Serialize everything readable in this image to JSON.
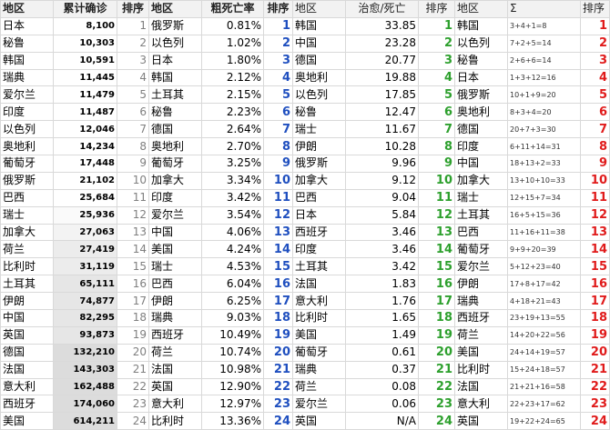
{
  "headers": {
    "region1": "地区",
    "cumulative": "累计确诊",
    "rank1": "排序",
    "region2": "地区",
    "mortality": "粗死亡率",
    "rank2": "排序",
    "region3": "地区",
    "recovery_death": "治愈/死亡",
    "rank3": "排序",
    "region4": "地区",
    "sigma": "Σ",
    "rank4": "排序"
  },
  "rows": [
    {
      "r1": "日本",
      "c": "8,100",
      "k1": "1",
      "r2": "俄罗斯",
      "m": "0.81%",
      "k2": "1",
      "r3": "韩国",
      "rd": "33.85",
      "k3": "1",
      "r4": "韩国",
      "s": "3+4+1=8",
      "k4": "1"
    },
    {
      "r1": "秘鲁",
      "c": "10,303",
      "k1": "2",
      "r2": "以色列",
      "m": "1.02%",
      "k2": "2",
      "r3": "中国",
      "rd": "23.28",
      "k3": "2",
      "r4": "以色列",
      "s": "7+2+5=14",
      "k4": "2"
    },
    {
      "r1": "韩国",
      "c": "10,591",
      "k1": "3",
      "r2": "日本",
      "m": "1.80%",
      "k2": "3",
      "r3": "德国",
      "rd": "20.77",
      "k3": "3",
      "r4": "秘鲁",
      "s": "2+6+6=14",
      "k4": "3"
    },
    {
      "r1": "瑞典",
      "c": "11,445",
      "k1": "4",
      "r2": "韩国",
      "m": "2.12%",
      "k2": "4",
      "r3": "奥地利",
      "rd": "19.88",
      "k3": "4",
      "r4": "日本",
      "s": "1+3+12=16",
      "k4": "4"
    },
    {
      "r1": "爱尔兰",
      "c": "11,479",
      "k1": "5",
      "r2": "土耳其",
      "m": "2.15%",
      "k2": "5",
      "r3": "以色列",
      "rd": "17.85",
      "k3": "5",
      "r4": "俄罗斯",
      "s": "10+1+9=20",
      "k4": "5"
    },
    {
      "r1": "印度",
      "c": "11,487",
      "k1": "6",
      "r2": "秘鲁",
      "m": "2.23%",
      "k2": "6",
      "r3": "秘鲁",
      "rd": "12.47",
      "k3": "6",
      "r4": "奥地利",
      "s": "8+3+4=20",
      "k4": "6"
    },
    {
      "r1": "以色列",
      "c": "12,046",
      "k1": "7",
      "r2": "德国",
      "m": "2.64%",
      "k2": "7",
      "r3": "瑞士",
      "rd": "11.67",
      "k3": "7",
      "r4": "德国",
      "s": "20+7+3=30",
      "k4": "7"
    },
    {
      "r1": "奥地利",
      "c": "14,234",
      "k1": "8",
      "r2": "奥地利",
      "m": "2.70%",
      "k2": "8",
      "r3": "伊朗",
      "rd": "10.28",
      "k3": "8",
      "r4": "印度",
      "s": "6+11+14=31",
      "k4": "8"
    },
    {
      "r1": "葡萄牙",
      "c": "17,448",
      "k1": "9",
      "r2": "葡萄牙",
      "m": "3.25%",
      "k2": "9",
      "r3": "俄罗斯",
      "rd": "9.96",
      "k3": "9",
      "r4": "中国",
      "s": "18+13+2=33",
      "k4": "9"
    },
    {
      "r1": "俄罗斯",
      "c": "21,102",
      "k1": "10",
      "r2": "加拿大",
      "m": "3.34%",
      "k2": "10",
      "r3": "加拿大",
      "rd": "9.12",
      "k3": "10",
      "r4": "加拿大",
      "s": "13+10+10=33",
      "k4": "10"
    },
    {
      "r1": "巴西",
      "c": "25,684",
      "k1": "11",
      "r2": "印度",
      "m": "3.42%",
      "k2": "11",
      "r3": "巴西",
      "rd": "9.04",
      "k3": "11",
      "r4": "瑞士",
      "s": "12+15+7=34",
      "k4": "11"
    },
    {
      "r1": "瑞士",
      "c": "25,936",
      "k1": "12",
      "r2": "爱尔兰",
      "m": "3.54%",
      "k2": "12",
      "r3": "日本",
      "rd": "5.84",
      "k3": "12",
      "r4": "土耳其",
      "s": "16+5+15=36",
      "k4": "12"
    },
    {
      "r1": "加拿大",
      "c": "27,063",
      "k1": "13",
      "r2": "中国",
      "m": "4.06%",
      "k2": "13",
      "r3": "西班牙",
      "rd": "3.46",
      "k3": "13",
      "r4": "巴西",
      "s": "11+16+11=38",
      "k4": "13"
    },
    {
      "r1": "荷兰",
      "c": "27,419",
      "k1": "14",
      "r2": "美国",
      "m": "4.24%",
      "k2": "14",
      "r3": "印度",
      "rd": "3.46",
      "k3": "14",
      "r4": "葡萄牙",
      "s": "9+9+20=39",
      "k4": "14"
    },
    {
      "r1": "比利时",
      "c": "31,119",
      "k1": "15",
      "r2": "瑞士",
      "m": "4.53%",
      "k2": "15",
      "r3": "土耳其",
      "rd": "3.42",
      "k3": "15",
      "r4": "爱尔兰",
      "s": "5+12+23=40",
      "k4": "15"
    },
    {
      "r1": "土耳其",
      "c": "65,111",
      "k1": "16",
      "r2": "巴西",
      "m": "6.04%",
      "k2": "16",
      "r3": "法国",
      "rd": "1.83",
      "k3": "16",
      "r4": "伊朗",
      "s": "17+8+17=42",
      "k4": "16"
    },
    {
      "r1": "伊朗",
      "c": "74,877",
      "k1": "17",
      "r2": "伊朗",
      "m": "6.25%",
      "k2": "17",
      "r3": "意大利",
      "rd": "1.76",
      "k3": "17",
      "r4": "瑞典",
      "s": "4+18+21=43",
      "k4": "17"
    },
    {
      "r1": "中国",
      "c": "82,295",
      "k1": "18",
      "r2": "瑞典",
      "m": "9.03%",
      "k2": "18",
      "r3": "比利时",
      "rd": "1.65",
      "k3": "18",
      "r4": "西班牙",
      "s": "23+19+13=55",
      "k4": "18"
    },
    {
      "r1": "英国",
      "c": "93,873",
      "k1": "19",
      "r2": "西班牙",
      "m": "10.49%",
      "k2": "19",
      "r3": "美国",
      "rd": "1.49",
      "k3": "19",
      "r4": "荷兰",
      "s": "14+20+22=56",
      "k4": "19"
    },
    {
      "r1": "德国",
      "c": "132,210",
      "k1": "20",
      "r2": "荷兰",
      "m": "10.74%",
      "k2": "20",
      "r3": "葡萄牙",
      "rd": "0.61",
      "k3": "20",
      "r4": "美国",
      "s": "24+14+19=57",
      "k4": "20"
    },
    {
      "r1": "法国",
      "c": "143,303",
      "k1": "21",
      "r2": "法国",
      "m": "10.98%",
      "k2": "21",
      "r3": "瑞典",
      "rd": "0.37",
      "k3": "21",
      "r4": "比利时",
      "s": "15+24+18=57",
      "k4": "21"
    },
    {
      "r1": "意大利",
      "c": "162,488",
      "k1": "22",
      "r2": "英国",
      "m": "12.90%",
      "k2": "22",
      "r3": "荷兰",
      "rd": "0.08",
      "k3": "22",
      "r4": "法国",
      "s": "21+21+16=58",
      "k4": "22"
    },
    {
      "r1": "西班牙",
      "c": "174,060",
      "k1": "23",
      "r2": "意大利",
      "m": "12.97%",
      "k2": "23",
      "r3": "爱尔兰",
      "rd": "0.06",
      "k3": "23",
      "r4": "意大利",
      "s": "22+23+17=62",
      "k4": "23"
    },
    {
      "r1": "美国",
      "c": "614,211",
      "k1": "24",
      "r2": "比利时",
      "m": "13.36%",
      "k2": "24",
      "r3": "英国",
      "rd": "N/A",
      "k3": "24",
      "r4": "英国",
      "s": "19+22+24=65",
      "k4": "24"
    }
  ]
}
